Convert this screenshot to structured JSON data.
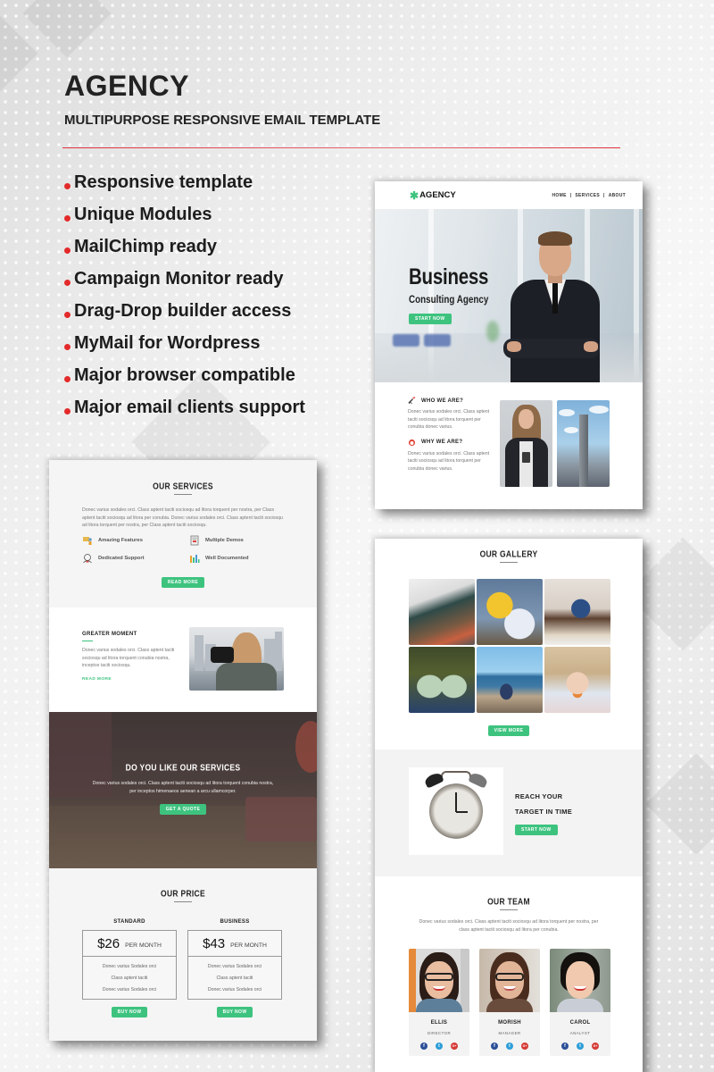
{
  "header": {
    "title": "AGENCY",
    "subtitle": "MULTIPURPOSE RESPONSIVE EMAIL TEMPLATE"
  },
  "features": [
    "Responsive template",
    "Unique Modules",
    "MailChimp ready",
    "Campaign Monitor ready",
    "Drag-Drop builder access",
    "MyMail for Wordpress",
    "Major browser compatible",
    "Major email clients support"
  ],
  "colors": {
    "accent_green": "#3ec37f",
    "bullet_red": "#e32a2a",
    "rule_red": "#e0303a",
    "facebook": "#2b4f98",
    "twitter": "#2e9ed8",
    "google_plus": "#d63a35"
  },
  "preview_top": {
    "logo_icon": "asterisk-gear-icon",
    "logo_text": "AGENCY",
    "nav": [
      "HOME",
      "|",
      "SERVICES",
      "|",
      "ABOUT"
    ],
    "hero": {
      "heading": "Business",
      "subheading": "Consulting Agency",
      "button": "START NOW"
    },
    "about": [
      {
        "icon": "telescope-icon",
        "title": "WHO WE ARE?",
        "text": "Donec varius sodales orci. Class aptent taciti sociosqu ad litora torquent per conubia donec varius."
      },
      {
        "icon": "support-icon",
        "title": "WHY WE ARE?",
        "text": "Donec varius sodales orci. Class aptent taciti sociosqu ad litora torquent per conubia donec varius."
      }
    ]
  },
  "preview_left": {
    "services": {
      "title": "OUR SERVICES",
      "text": "Donec varius sodales orci. Class aptent taciti sociosqu ad litora torquent per nostra, per Class aptent taciti sociosqu ad litora per conubia. Donec varius sodales orci. Class aptent taciti sociosqu ad litora torquent per nostra, per Class aptent taciti sociosqu.",
      "items": [
        {
          "icon": "presentation-icon",
          "label": "Amazing Features"
        },
        {
          "icon": "document-icon",
          "label": "Multiple Demos"
        },
        {
          "icon": "support-agent-icon",
          "label": "Dedicated Support"
        },
        {
          "icon": "bar-chart-icon",
          "label": "Well Documented"
        }
      ],
      "button": "READ MORE"
    },
    "moment": {
      "title": "GREATER MOMENT",
      "text": "Donec varius sodales orci. Class aptent taciti sociosqu ad litora torquent conubia nostra, inceptos taciti sociosqu.",
      "link": "READ MORE"
    },
    "cta": {
      "title": "DO YOU LIKE OUR SERVICES",
      "text": "Donec varius sodales orci. Class aptent taciti sociosqu ad litora torquent conubia nostra, per inceptos himenaeos aenean a arcu ullamcorper.",
      "button": "GET A QUOTE"
    },
    "price": {
      "title": "OUR PRICE",
      "plans": [
        {
          "name": "STANDARD",
          "amount": "$26",
          "period": "PER MONTH",
          "features": [
            "Donec varius Sodales orci",
            "Class aptent taciti",
            "Donec varius Sodales orci"
          ],
          "button": "BUY NOW"
        },
        {
          "name": "BUSINESS",
          "amount": "$43",
          "period": "PER MONTH",
          "features": [
            "Donec varius Sodales orci",
            "Class aptent taciti",
            "Donec varius Sodales orci"
          ],
          "button": "BUY NOW"
        }
      ]
    }
  },
  "preview_right": {
    "gallery": {
      "title": "OUR GALLERY",
      "images": [
        "man-sitting-sneakers",
        "hot-air-balloons",
        "man-on-bench",
        "green-sneakers",
        "woman-at-beach",
        "girl-eating-fruit"
      ],
      "button": "VIEW MORE"
    },
    "reach": {
      "title_line1": "REACH YOUR",
      "title_line2": "TARGET IN TIME",
      "button": "START NOW"
    },
    "team": {
      "title": "OUR TEAM",
      "text": "Donec varius sodales orci. Class aptent taciti sociosqu ad litora torquent per nostra, per class aptent taciti sociosqu ad litora per conubia.",
      "members": [
        {
          "name": "ELLIS",
          "role": "DIRECTOR"
        },
        {
          "name": "MORISH",
          "role": "MANAGER"
        },
        {
          "name": "CAROL",
          "role": "ANALYST"
        }
      ],
      "social_icons": [
        "f",
        "t",
        "G+"
      ]
    }
  }
}
